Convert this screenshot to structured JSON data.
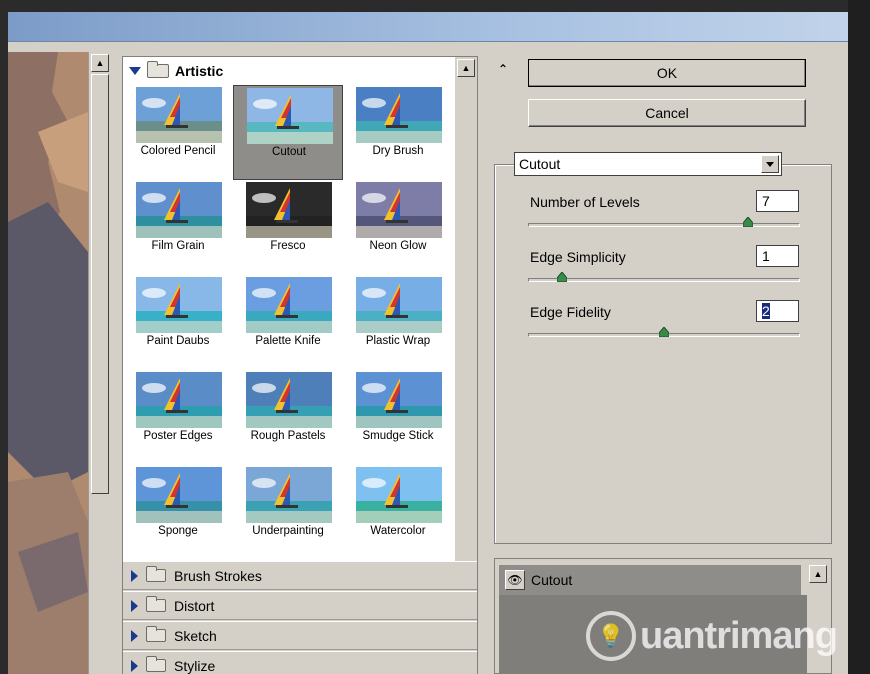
{
  "gallery": {
    "open_category": "Artistic",
    "filters": [
      {
        "label": "Colored Pencil",
        "icon": "colored-pencil-thumbnail"
      },
      {
        "label": "Cutout",
        "icon": "cutout-thumbnail",
        "selected": true
      },
      {
        "label": "Dry Brush",
        "icon": "dry-brush-thumbnail"
      },
      {
        "label": "Film Grain",
        "icon": "film-grain-thumbnail"
      },
      {
        "label": "Fresco",
        "icon": "fresco-thumbnail"
      },
      {
        "label": "Neon Glow",
        "icon": "neon-glow-thumbnail"
      },
      {
        "label": "Paint Daubs",
        "icon": "paint-daubs-thumbnail"
      },
      {
        "label": "Palette Knife",
        "icon": "palette-knife-thumbnail"
      },
      {
        "label": "Plastic Wrap",
        "icon": "plastic-wrap-thumbnail"
      },
      {
        "label": "Poster Edges",
        "icon": "poster-edges-thumbnail"
      },
      {
        "label": "Rough Pastels",
        "icon": "rough-pastels-thumbnail"
      },
      {
        "label": "Smudge Stick",
        "icon": "smudge-stick-thumbnail"
      },
      {
        "label": "Sponge",
        "icon": "sponge-thumbnail"
      },
      {
        "label": "Underpainting",
        "icon": "underpainting-thumbnail"
      },
      {
        "label": "Watercolor",
        "icon": "watercolor-thumbnail"
      }
    ],
    "collapsed_categories": [
      "Brush Strokes",
      "Distort",
      "Sketch",
      "Stylize"
    ]
  },
  "buttons": {
    "ok": "OK",
    "cancel": "Cancel"
  },
  "settings": {
    "filter_select": "Cutout",
    "params": [
      {
        "label": "Number of Levels",
        "value": "7",
        "level": 0.83
      },
      {
        "label": "Edge Simplicity",
        "value": "1",
        "level": 0.1
      },
      {
        "label": "Edge Fidelity",
        "value": "2",
        "level": 0.5,
        "selected": true
      }
    ]
  },
  "layers": {
    "active": "Cutout"
  },
  "watermark": {
    "text": "uantrimang"
  },
  "colors": {
    "panel": "#d4d0c8",
    "selected_thumb": "#8f8d8a",
    "accent": "#1a3a8c",
    "preview": "#b08a6e"
  }
}
